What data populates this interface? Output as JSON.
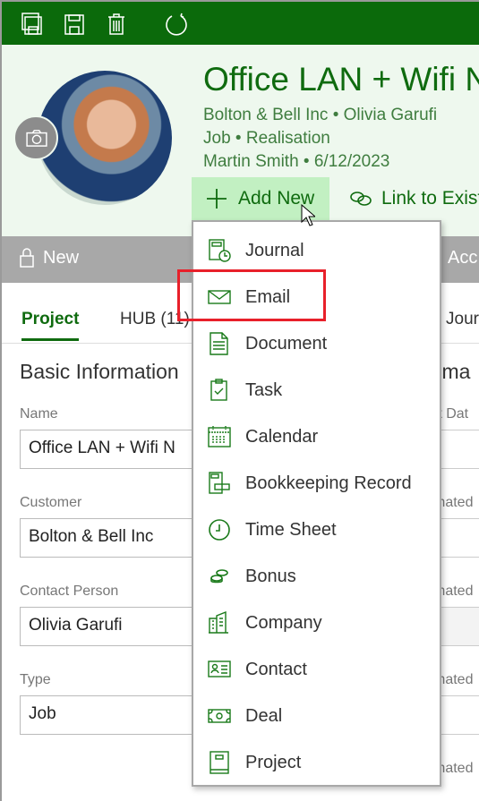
{
  "toolbar": {
    "icons": [
      "save-all-icon",
      "save-icon",
      "delete-icon",
      "refresh-icon"
    ]
  },
  "header": {
    "title": "Office LAN + Wifi N",
    "line1": "Bolton & Bell Inc • Olivia Garufi",
    "line2": "Job • Realisation",
    "line3": "Martin Smith • 6/12/2023",
    "add_new": "Add New",
    "link_existing": "Link to Exist"
  },
  "status_bar": {
    "state": "New",
    "right_fragment": "Acc"
  },
  "tabs": [
    {
      "label": "Project",
      "active": true
    },
    {
      "label": "HUB (11)"
    },
    {
      "label": "Jour"
    }
  ],
  "basic": {
    "heading": "Basic Information",
    "fields": [
      {
        "label": "Name",
        "value": "Office LAN + Wifi N"
      },
      {
        "label": "Customer",
        "value": "Bolton & Bell Inc"
      },
      {
        "label": "Contact Person",
        "value": "Olivia Garufi"
      },
      {
        "label": "Type",
        "value": "Job"
      }
    ]
  },
  "right": {
    "heading": "tima",
    "labels": [
      "rt Dat",
      "mated",
      "mated",
      "mated",
      "mated"
    ]
  },
  "menu": {
    "items": [
      {
        "label": "Journal",
        "icon": "journal-icon"
      },
      {
        "label": "Email",
        "icon": "email-icon",
        "highlighted": true
      },
      {
        "label": "Document",
        "icon": "document-icon"
      },
      {
        "label": "Task",
        "icon": "task-icon"
      },
      {
        "label": "Calendar",
        "icon": "calendar-icon"
      },
      {
        "label": "Bookkeeping Record",
        "icon": "bookkeeping-icon"
      },
      {
        "label": "Time Sheet",
        "icon": "clock-icon"
      },
      {
        "label": "Bonus",
        "icon": "coins-icon"
      },
      {
        "label": "Company",
        "icon": "building-icon"
      },
      {
        "label": "Contact",
        "icon": "contact-card-icon"
      },
      {
        "label": "Deal",
        "icon": "money-icon"
      },
      {
        "label": "Project",
        "icon": "project-icon"
      }
    ]
  },
  "colors": {
    "brand": "#0b6a0b",
    "header_bg": "#eef8ee",
    "add_new_bg": "#c2f0c2",
    "highlight": "#e8202a"
  }
}
